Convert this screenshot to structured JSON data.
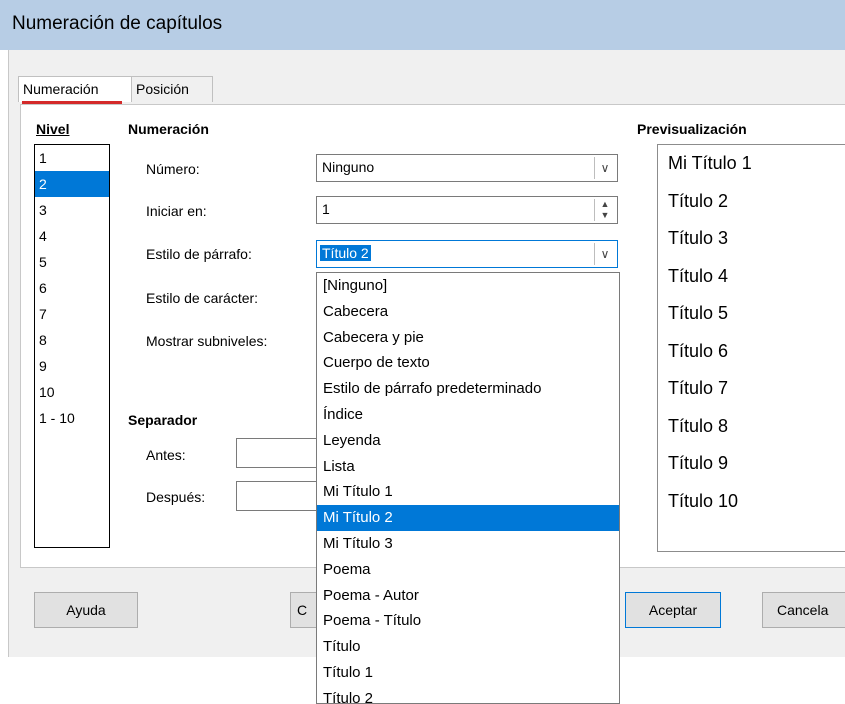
{
  "window": {
    "title": "Numeración de capítulos"
  },
  "tabs": [
    {
      "label": "Numeración"
    },
    {
      "label": "Posición"
    }
  ],
  "level": {
    "header": "Nivel",
    "items": [
      "1",
      "2",
      "3",
      "4",
      "5",
      "6",
      "7",
      "8",
      "9",
      "10",
      "1 - 10"
    ],
    "selected_index": 1
  },
  "numbering": {
    "header": "Numeración",
    "number_label": "Número:",
    "number_value": "Ninguno",
    "start_label": "Iniciar en:",
    "start_value": "1",
    "para_style_label": "Estilo de párrafo:",
    "para_style_value": "Título 2",
    "char_style_label": "Estilo de carácter:",
    "show_sublevels_label": "Mostrar subniveles:"
  },
  "separator": {
    "header": "Separador",
    "before_label": "Antes:",
    "after_label": "Después:"
  },
  "preview": {
    "header": "Previsualización",
    "items": [
      "Mi Título 1",
      "Título 2",
      "Título 3",
      "Título 4",
      "Título 5",
      "Título 6",
      "Título 7",
      "Título 8",
      "Título 9",
      "Título 10"
    ]
  },
  "dropdown": {
    "options": [
      "[Ninguno]",
      "Cabecera",
      "Cabecera y pie",
      "Cuerpo de texto",
      "Estilo de párrafo predeterminado",
      "Índice",
      "Leyenda",
      "Lista",
      "Mi Título 1",
      "Mi Título 2",
      "Mi Título 3",
      "Poema",
      "Poema - Autor",
      "Poema - Título",
      "Título",
      "Título 1",
      "Título 2"
    ],
    "highlighted_index": 9
  },
  "buttons": {
    "help": "Ayuda",
    "ok": "Aceptar",
    "cancel_partial": "Cancela",
    "hidden_partial": "C"
  },
  "icons": {
    "dropdown_arrow": "chevron-down-icon",
    "spinner": "spinner-arrows-icon"
  },
  "colors": {
    "titlebar": "#b7cde5",
    "selection": "#0078d7",
    "tab_underline": "#d42a2a"
  }
}
